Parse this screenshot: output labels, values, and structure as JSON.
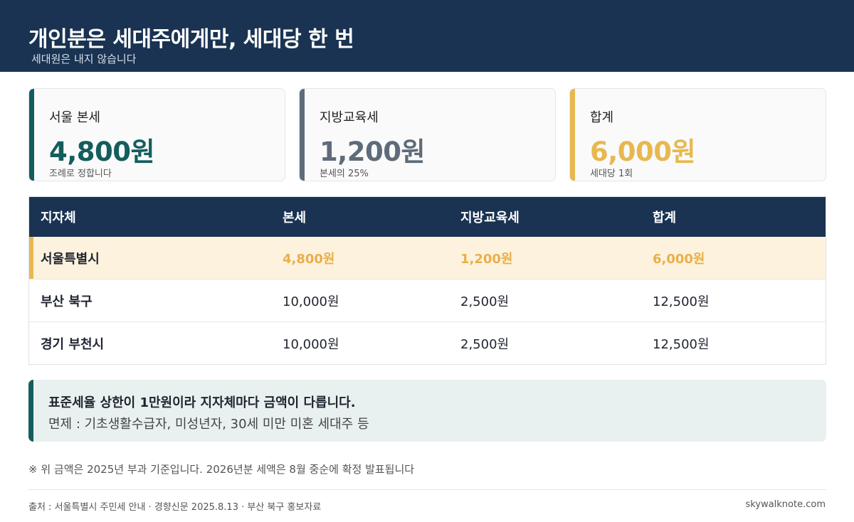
{
  "header": {
    "title": "개인분은 세대주에게만, 세대당 한 번",
    "subtitle": "세대원은 내지 않습니다"
  },
  "cards": [
    {
      "label": "서울 본세",
      "value": "4,800원",
      "note": "조례로 정합니다",
      "color": "#145d5d"
    },
    {
      "label": "지방교육세",
      "value": "1,200원",
      "note": "본세의 25%",
      "color": "#5f6b78"
    },
    {
      "label": "합계",
      "value": "6,000원",
      "note": "세대당 1회",
      "color": "#e8b84f"
    }
  ],
  "table": {
    "headers": [
      "지자체",
      "본세",
      "지방교육세",
      "합계"
    ],
    "rows": [
      [
        "서울특별시",
        "4,800원",
        "1,200원",
        "6,000원"
      ],
      [
        "부산 북구",
        "10,000원",
        "2,500원",
        "12,500원"
      ],
      [
        "경기 부천시",
        "10,000원",
        "2,500원",
        "12,500원"
      ]
    ],
    "highlight_color": "#fdf2dd"
  },
  "notice": {
    "main": "표준세율 상한이 1만원이라 지자체마다 금액이 다릅니다.",
    "sub": "면제 : 기초생활수급자, 미성년자, 30세 미만 미혼 세대주 등"
  },
  "footnote": "※ 위 금액은 2025년 부과 기준입니다. 2026년분 세액은 8월 중순에 확정 발표됩니다",
  "source": "출처 : 서울특별시 주민세 안내 · 경향신문 2025.8.13 · 부산 북구 홍보자료",
  "site": "skywalknote.com",
  "colors": {
    "header_bg": "#1a3352",
    "accent_teal": "#145d5d",
    "accent_gray": "#5f6b78",
    "accent_gold": "#e8b84f"
  }
}
